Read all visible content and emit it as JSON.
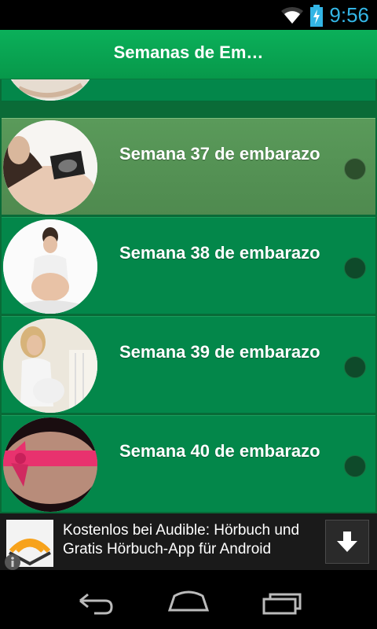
{
  "status_bar": {
    "time": "9:56",
    "icons": [
      "wifi-icon",
      "battery-charging-icon"
    ]
  },
  "action_bar": {
    "title": "Semanas de Em…"
  },
  "list": {
    "items": [
      {
        "label": "Semana 37 de embarazo",
        "selected": true
      },
      {
        "label": "Semana 38 de embarazo",
        "selected": false
      },
      {
        "label": "Semana 39 de embarazo",
        "selected": false
      },
      {
        "label": "Semana 40 de embarazo",
        "selected": false
      }
    ]
  },
  "ad": {
    "line1": "Kostenlos bei Audible: Hörbuch und",
    "line2": "Gratis Hörbuch-App für Android",
    "icons": [
      "audible-logo-icon",
      "download-icon",
      "info-icon"
    ]
  },
  "nav_bar": {
    "icons": [
      "back-icon",
      "home-icon",
      "recent-apps-icon"
    ]
  },
  "colors": {
    "accent": "#33b5e5",
    "card": "#03874a",
    "selected_card": "#5a9a5a",
    "action_bar": "#0bb05a"
  }
}
